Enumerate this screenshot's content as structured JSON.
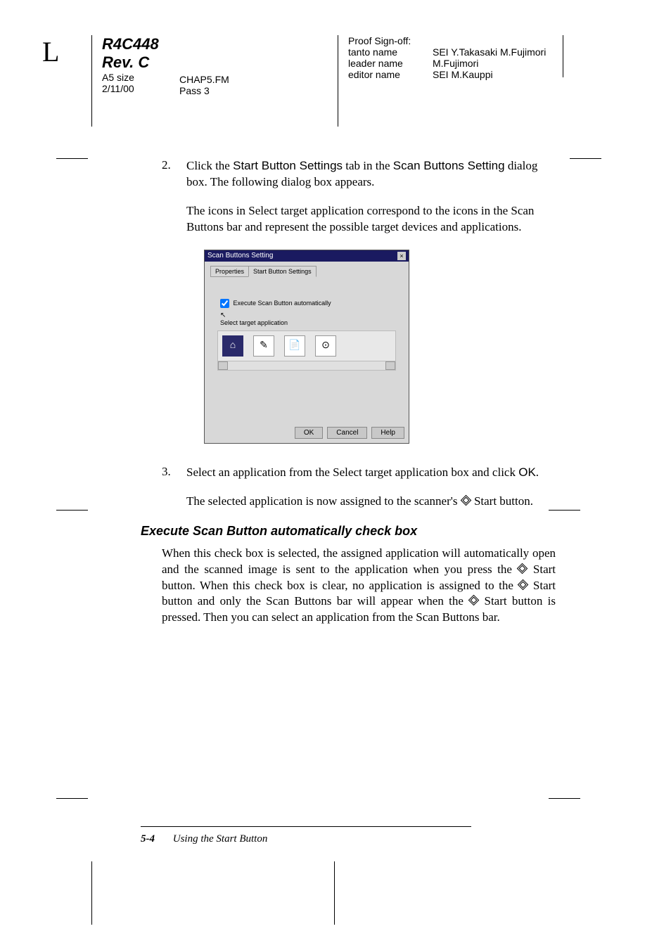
{
  "header": {
    "side_letter": "L",
    "model": "R4C448",
    "rev": "Rev. C",
    "size": "A5 size",
    "date": "2/11/00",
    "file": "CHAP5.FM",
    "pass": "Pass 3",
    "proof_label": "Proof Sign-off:",
    "tanto_label": "tanto name",
    "tanto_value": "SEI Y.Takasaki M.Fujimori",
    "leader_label": "leader name",
    "leader_value": "M.Fujimori",
    "editor_label": "editor name",
    "editor_value": "SEI M.Kauppi"
  },
  "step2": {
    "num": "2.",
    "line1_a": "Click the ",
    "line1_b": "Start Button Settings",
    "line1_c": " tab in the ",
    "line1_d": "Scan Buttons Setting",
    "line1_e": " dialog box. The following dialog box appears.",
    "para2": "The icons in Select target application correspond to the icons in the Scan Buttons bar and represent the possible target devices and applications."
  },
  "screenshot": {
    "title": "Scan Buttons Setting",
    "tab1": "Properties",
    "tab2": "Start Button Settings",
    "checkbox": "Execute Scan Button automatically",
    "select_label": "Select target application",
    "ok": "OK",
    "cancel": "Cancel",
    "help": "Help"
  },
  "step3": {
    "num": "3.",
    "line1_a": "Select an application from the Select target application box and click ",
    "line1_b": "OK",
    "line1_c": ".",
    "para2_a": "The selected application is now assigned to the scanner's ",
    "para2_b": " Start button."
  },
  "exec": {
    "heading": "Execute Scan Button automatically check box",
    "para_a": "When this check box is selected, the assigned application will automatically open and the scanned image is sent to the application when you press the ",
    "para_b": " Start button. When this check box is clear, no application is assigned to the ",
    "para_c": " Start button and only the Scan Buttons bar will appear when the ",
    "para_d": " Start button is pressed. Then you can select an application from the Scan Buttons bar."
  },
  "footer": {
    "page": "5-4",
    "title": "Using the Start Button"
  }
}
